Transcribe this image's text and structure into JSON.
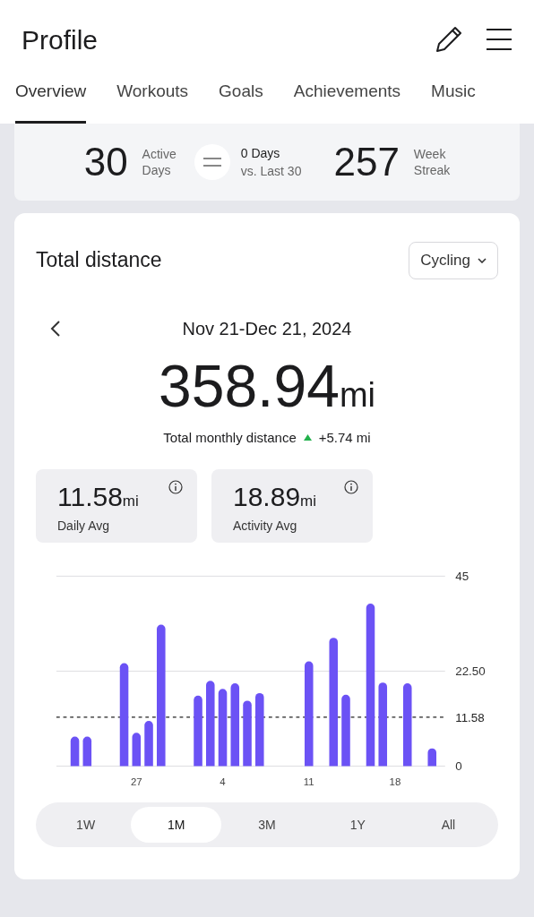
{
  "header": {
    "title": "Profile"
  },
  "tabs": [
    {
      "label": "Overview",
      "selected": true
    },
    {
      "label": "Workouts",
      "selected": false
    },
    {
      "label": "Goals",
      "selected": false
    },
    {
      "label": "Achievements",
      "selected": false
    },
    {
      "label": "Music",
      "selected": false
    }
  ],
  "summary": {
    "active_days": {
      "value": "30",
      "label_1": "Active",
      "label_2": "Days"
    },
    "comparison": {
      "line_1": "0 Days",
      "line_2": "vs. Last 30"
    },
    "streak": {
      "value": "257",
      "label_1": "Week",
      "label_2": "Streak"
    }
  },
  "distance_card": {
    "title": "Total distance",
    "sport_select": "Cycling",
    "date_range": "Nov 21-Dec 21, 2024",
    "total": "358.94",
    "total_unit": "mi",
    "caption": "Total monthly distance",
    "change": "+5.74 mi",
    "stats": [
      {
        "value": "11.58",
        "unit": "mi",
        "label": "Daily Avg"
      },
      {
        "value": "18.89",
        "unit": "mi",
        "label": "Activity Avg"
      }
    ],
    "chart_data": {
      "type": "bar",
      "categories": [
        null,
        null,
        null,
        null,
        null,
        null,
        "27",
        null,
        null,
        null,
        null,
        null,
        null,
        "4",
        null,
        null,
        null,
        null,
        null,
        null,
        "11",
        null,
        null,
        null,
        null,
        null,
        null,
        "18",
        null,
        null,
        null
      ],
      "series": [
        {
          "color": "#6b52f5",
          "values": [
            0,
            7,
            7,
            0,
            0,
            24.4,
            7.9,
            10.7,
            33.5,
            0,
            0,
            16.7,
            20.2,
            18.3,
            19.6,
            15.5,
            17.3,
            0,
            0,
            0,
            24.8,
            0,
            30.4,
            16.9,
            0,
            38.5,
            19.8,
            0,
            19.6,
            0,
            4.2
          ]
        }
      ],
      "ylim": [
        0,
        45
      ],
      "yticks": [
        0,
        {
          "value": 22.5,
          "label": "22.50"
        },
        45
      ],
      "ref_lines": [
        {
          "axis": "y",
          "value": 11.58,
          "label": "11.58"
        }
      ]
    },
    "ranges": [
      {
        "label": "1W",
        "selected": false
      },
      {
        "label": "1M",
        "selected": true
      },
      {
        "label": "3M",
        "selected": false
      },
      {
        "label": "1Y",
        "selected": false
      },
      {
        "label": "All",
        "selected": false
      }
    ]
  }
}
